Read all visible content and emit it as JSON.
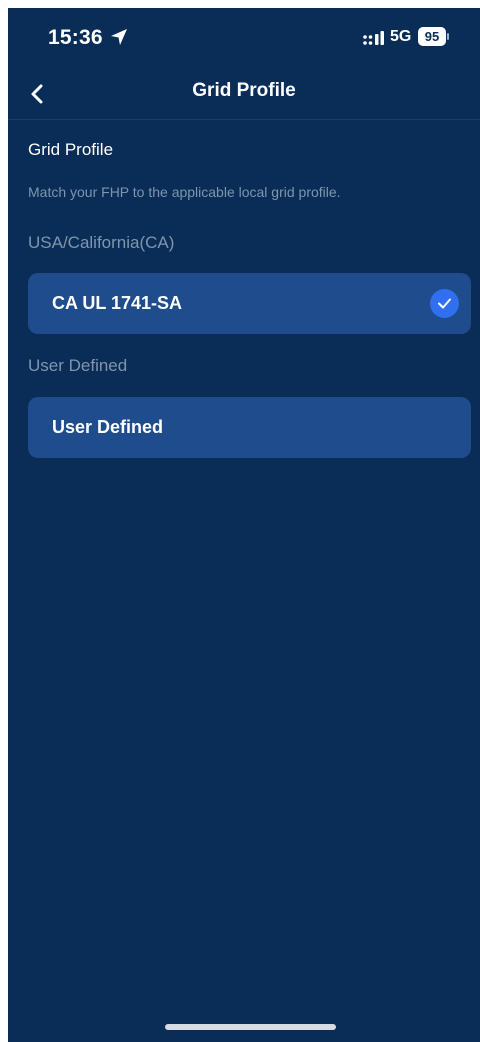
{
  "status_bar": {
    "time": "15:36",
    "network": "5G",
    "battery": "95"
  },
  "nav": {
    "title": "Grid Profile",
    "back_icon": "chevron-left-icon"
  },
  "content": {
    "title": "Grid Profile",
    "description": "Match your FHP to the applicable local grid profile.",
    "groups": [
      {
        "label": "USA/California(CA)",
        "option": {
          "label": "CA UL 1741-SA",
          "selected": true
        }
      },
      {
        "label": "User Defined",
        "option": {
          "label": "User Defined",
          "selected": false
        }
      }
    ]
  },
  "colors": {
    "background": "#0a2d57",
    "card": "#1e4c8c",
    "check": "#2f6ff0",
    "muted_text": "#7f95ad"
  }
}
